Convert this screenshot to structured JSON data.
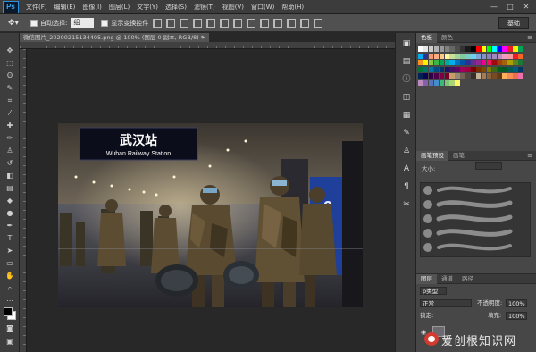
{
  "app": {
    "logo": "Ps"
  },
  "menubar": {
    "items": [
      "文件(F)",
      "编辑(E)",
      "图像(I)",
      "图层(L)",
      "文字(Y)",
      "选择(S)",
      "滤镜(T)",
      "视图(V)",
      "窗口(W)",
      "帮助(H)"
    ],
    "window_controls": [
      "—",
      "□",
      "✕"
    ]
  },
  "options_bar": {
    "auto_select_label": "自动选择:",
    "auto_select_value": "组",
    "show_transform_label": "显示变换控件",
    "workspace_label": "基础"
  },
  "document": {
    "tab_title": "微信图片_20200215134405.png @ 100% (图层 0 副本, RGB/8) *",
    "close_label": "×"
  },
  "photo": {
    "sign_cn": "武汉站",
    "sign_en": "Wuhan Railway Station",
    "side_sign": "2"
  },
  "swatches_panel": {
    "tabs": [
      "色板",
      "颜色"
    ],
    "menu": "≡",
    "colors": [
      "#ffffff",
      "#e6e6e6",
      "#cccccc",
      "#b3b3b3",
      "#999999",
      "#808080",
      "#666666",
      "#4d4d4d",
      "#333333",
      "#1a1a1a",
      "#000000",
      "#ff0000",
      "#ffff00",
      "#00ff00",
      "#00ffff",
      "#0000ff",
      "#ff00ff",
      "#ed1c24",
      "#fff200",
      "#00a651",
      "#00aeef",
      "#2e3192",
      "#f7977a",
      "#f9ad81",
      "#fdc68a",
      "#fff79a",
      "#c4df9b",
      "#a2d39c",
      "#82ca9d",
      "#7bcdc8",
      "#6ecff6",
      "#7ea7d8",
      "#8493ca",
      "#8882be",
      "#a187be",
      "#bc8dbf",
      "#f49ac2",
      "#f6989d",
      "#ee1d24",
      "#f26522",
      "#f7941d",
      "#fff200",
      "#8dc63f",
      "#39b54a",
      "#00a651",
      "#00a99d",
      "#00aeef",
      "#0072bc",
      "#0054a6",
      "#2e3192",
      "#662d91",
      "#92278f",
      "#ec008c",
      "#ed145b",
      "#9e0b0f",
      "#a0410d",
      "#a3620a",
      "#aba000",
      "#598527",
      "#1a7b30",
      "#007236",
      "#00746b",
      "#0076a3",
      "#004a80",
      "#003471",
      "#1b1464",
      "#440e62",
      "#630460",
      "#9e005d",
      "#9e0039",
      "#790000",
      "#7b2e00",
      "#7d4900",
      "#827b00",
      "#406618",
      "#005e20",
      "#005826",
      "#005952",
      "#005b7f",
      "#003663",
      "#002157",
      "#0d004c",
      "#32004b",
      "#4b0049",
      "#7b0046",
      "#7a0026",
      "#c69c6d",
      "#998675",
      "#736357",
      "#534741",
      "#37302a",
      "#c7b299",
      "#a67c52",
      "#8c6239",
      "#754c24",
      "#603913",
      "#fbaf5d",
      "#f68e56",
      "#f26c4f",
      "#f06eaa",
      "#bd8cbf",
      "#855fa8",
      "#5574b9",
      "#448ccb",
      "#3cb878",
      "#7cc576",
      "#acd373",
      "#fff568"
    ]
  },
  "brush_panel": {
    "tabs": [
      "画笔预设",
      "画笔"
    ],
    "size_label": "大小:",
    "menu": "≡"
  },
  "layers_panel": {
    "tabs": [
      "图层",
      "通道",
      "路径"
    ],
    "kind_label": "ρ类型",
    "blend_mode": "正常",
    "opacity_label": "不透明度:",
    "opacity_value": "100%",
    "lock_label": "锁定:",
    "fill_label": "填充:",
    "fill_value": "100%"
  },
  "watermark": {
    "text": "爱创根知识网"
  }
}
